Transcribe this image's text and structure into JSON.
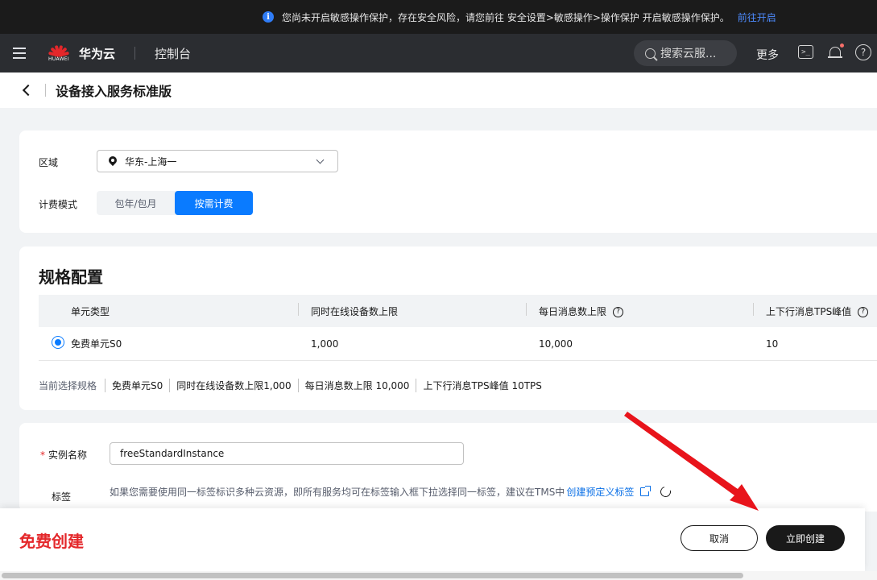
{
  "notice": {
    "text": "您尚未开启敏感操作保护，存在安全风险，请您前往 安全设置>敏感操作>操作保护 开启敏感操作保护。",
    "link": "前往开启"
  },
  "header": {
    "brand_small": "HUAWEI",
    "brand": "华为云",
    "console": "控制台",
    "search_placeholder": "搜索云服...",
    "more": "更多"
  },
  "subheader": {
    "title": "设备接入服务标准版"
  },
  "region": {
    "label": "区域",
    "value": "华东-上海一"
  },
  "billing": {
    "label": "计费模式",
    "options": [
      "包年/包月",
      "按需计费"
    ],
    "selected": "按需计费"
  },
  "spec": {
    "title": "规格配置",
    "columns": [
      "单元类型",
      "同时在线设备数上限",
      "每日消息数上限",
      "上下行消息TPS峰值"
    ],
    "rows": [
      {
        "type": "免费单元S0",
        "online": "1,000",
        "daily": "10,000",
        "tps": "10"
      }
    ],
    "summary_label": "当前选择规格",
    "summary_items": [
      "免费单元S0",
      "同时在线设备数上限1,000",
      "每日消息数上限 10,000",
      "上下行消息TPS峰值 10TPS"
    ]
  },
  "instance": {
    "label": "实例名称",
    "required_mark": "*",
    "value": "freeStandardInstance"
  },
  "tag": {
    "label": "标签",
    "hint": "如果您需要使用同一标签标识多种云资源，即所有服务均可在标签输入框下拉选择同一标签，建议在TMS中",
    "link": "创建预定义标签"
  },
  "footer": {
    "free_create": "免费创建",
    "cancel": "取消",
    "create": "立即创建"
  },
  "colors": {
    "accent": "#0a7bff",
    "danger": "#e4272a",
    "dark": "#191919"
  },
  "icons": [
    "info-icon",
    "menu-icon",
    "huawei-logo",
    "search-icon",
    "terminal-icon",
    "bell-icon",
    "help-icon",
    "back-icon",
    "location-pin-icon",
    "chevron-down-icon",
    "question-icon",
    "external-link-icon",
    "refresh-icon",
    "red-arrow-annotation"
  ]
}
